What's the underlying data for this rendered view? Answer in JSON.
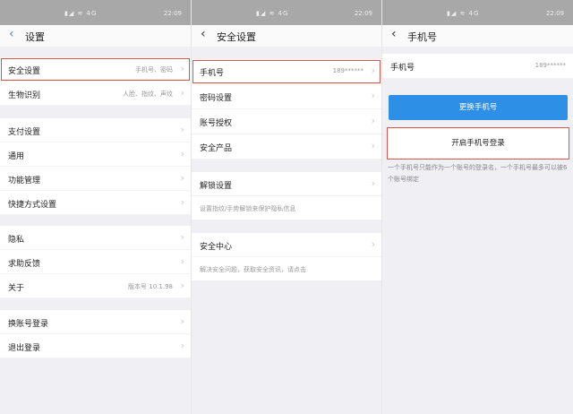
{
  "status": {
    "time": "22:09",
    "signal": "▮◢ ≋ 4G"
  },
  "settings": {
    "title": "设置",
    "groups": [
      [
        {
          "label": "安全设置",
          "value": "手机号、密码"
        },
        {
          "label": "生物识别",
          "value": "人脸、指纹、声纹"
        }
      ],
      [
        {
          "label": "支付设置"
        },
        {
          "label": "通用"
        },
        {
          "label": "功能管理"
        },
        {
          "label": "快捷方式设置"
        }
      ],
      [
        {
          "label": "隐私"
        },
        {
          "label": "求助反馈"
        },
        {
          "label": "关于",
          "value": "版本号 10.1.98"
        }
      ],
      [
        {
          "label": "换账号登录"
        },
        {
          "label": "退出登录"
        }
      ]
    ]
  },
  "security": {
    "title": "安全设置",
    "items": [
      {
        "label": "手机号",
        "value": "189******"
      },
      {
        "label": "密码设置"
      },
      {
        "label": "账号授权"
      },
      {
        "label": "安全产品"
      }
    ],
    "unlock": {
      "label": "解锁设置",
      "desc": "设置指纹/手势解锁来保护隐私信息"
    },
    "center": {
      "label": "安全中心",
      "desc": "解决安全问题，获取安全资讯，请点击"
    }
  },
  "phone": {
    "title": "手机号",
    "label": "手机号",
    "value": "189******",
    "change_button": "更换手机号",
    "enable_button": "开启手机号登录",
    "note": "一个手机号只能作为一个账号的登录名，一个手机号最多可以被6个账号绑定"
  }
}
